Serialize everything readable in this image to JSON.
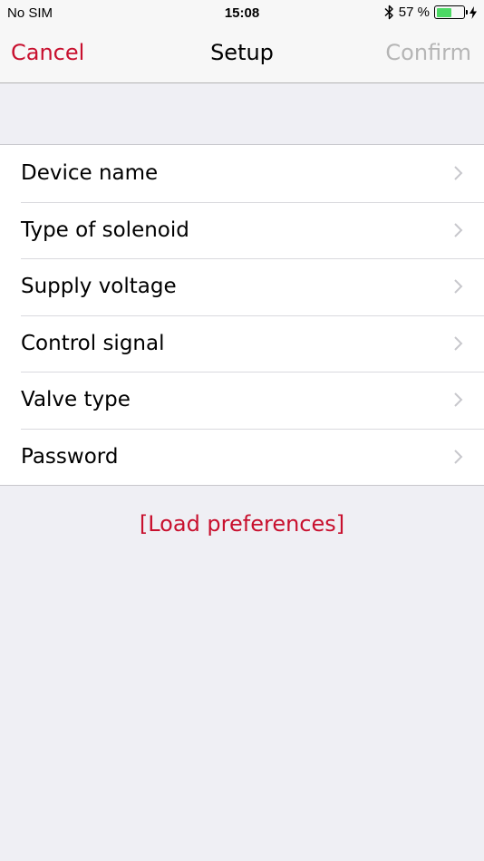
{
  "status_bar": {
    "carrier": "No SIM",
    "time": "15:08",
    "battery_percent": "57 %",
    "battery_level": 0.57,
    "battery_color": "#4cd964"
  },
  "nav": {
    "cancel_label": "Cancel",
    "title": "Setup",
    "confirm_label": "Confirm"
  },
  "settings": {
    "items": [
      {
        "label": "Device name"
      },
      {
        "label": "Type of solenoid"
      },
      {
        "label": "Supply voltage"
      },
      {
        "label": "Control signal"
      },
      {
        "label": "Valve type"
      },
      {
        "label": "Password"
      }
    ]
  },
  "load_preferences_label": "[Load preferences]",
  "colors": {
    "accent": "#c8102e",
    "disabled": "#b5b5b5",
    "background": "#efeff4"
  },
  "icons": {
    "bluetooth": "bluetooth-icon",
    "battery": "battery-icon",
    "charging": "charging-bolt-icon",
    "chevron": "chevron-right-icon"
  }
}
